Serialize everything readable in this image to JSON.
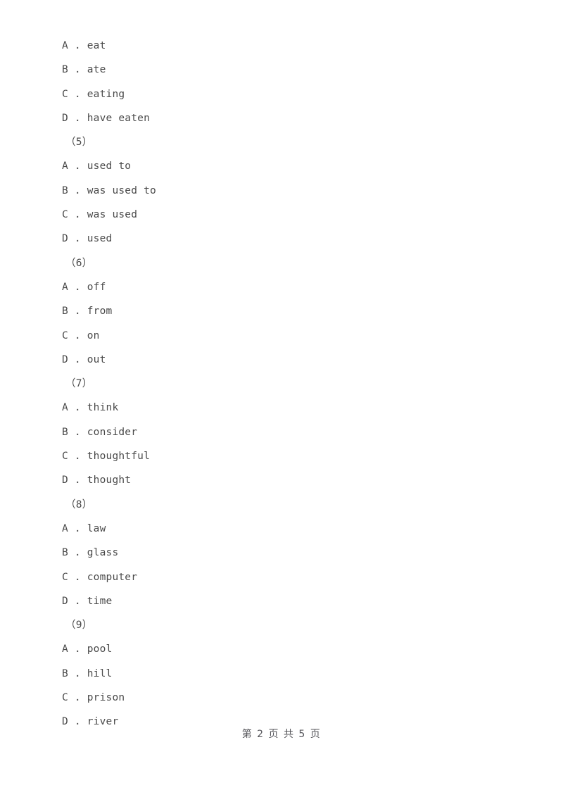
{
  "document": {
    "page_background": "#ffffff",
    "text_color": "#4a4a4a",
    "footer_color": "#55555a"
  },
  "lines": [
    {
      "type": "option",
      "text": "A . eat"
    },
    {
      "type": "option",
      "text": "B . ate"
    },
    {
      "type": "option",
      "text": "C . eating"
    },
    {
      "type": "option",
      "text": "D . have eaten"
    },
    {
      "type": "qnum",
      "text": "（5）"
    },
    {
      "type": "option",
      "text": "A . used to"
    },
    {
      "type": "option",
      "text": "B . was used to"
    },
    {
      "type": "option",
      "text": "C . was used"
    },
    {
      "type": "option",
      "text": "D . used"
    },
    {
      "type": "qnum",
      "text": "（6）"
    },
    {
      "type": "option",
      "text": "A . off"
    },
    {
      "type": "option",
      "text": "B . from"
    },
    {
      "type": "option",
      "text": "C . on"
    },
    {
      "type": "option",
      "text": "D . out"
    },
    {
      "type": "qnum",
      "text": "（7）"
    },
    {
      "type": "option",
      "text": "A . think"
    },
    {
      "type": "option",
      "text": "B . consider"
    },
    {
      "type": "option",
      "text": "C . thoughtful"
    },
    {
      "type": "option",
      "text": "D . thought"
    },
    {
      "type": "qnum",
      "text": "（8）"
    },
    {
      "type": "option",
      "text": "A . law"
    },
    {
      "type": "option",
      "text": "B . glass"
    },
    {
      "type": "option",
      "text": "C . computer"
    },
    {
      "type": "option",
      "text": "D . time"
    },
    {
      "type": "qnum",
      "text": "（9）"
    },
    {
      "type": "option",
      "text": "A . pool"
    },
    {
      "type": "option",
      "text": "B . hill"
    },
    {
      "type": "option",
      "text": "C . prison"
    },
    {
      "type": "option",
      "text": "D . river"
    }
  ],
  "footer": {
    "text": "第 2 页 共 5 页",
    "current_page": "2",
    "total_pages": "5"
  }
}
